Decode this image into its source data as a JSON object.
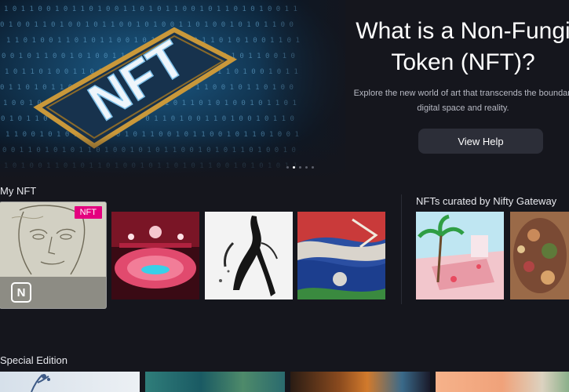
{
  "hero": {
    "title": "What is a Non-Fungi\nToken (NFT)?",
    "subtitle": "Explore the new world of art that transcends the boundari\ndigital space and reality.",
    "button_label": "View Help",
    "art_text": "NFT",
    "slide_count": 5,
    "active_slide": 1
  },
  "my_nft": {
    "title": "My NFT",
    "badge": "NFT",
    "logo_letter": "N"
  },
  "curated": {
    "title": "NFTs curated by Nifty Gateway"
  },
  "special_edition": {
    "title": "Special Edition"
  },
  "colors": {
    "background": "#15161d",
    "badge": "#e4007f",
    "button": "#2c2e38",
    "frame_gold": "#c9983a"
  }
}
